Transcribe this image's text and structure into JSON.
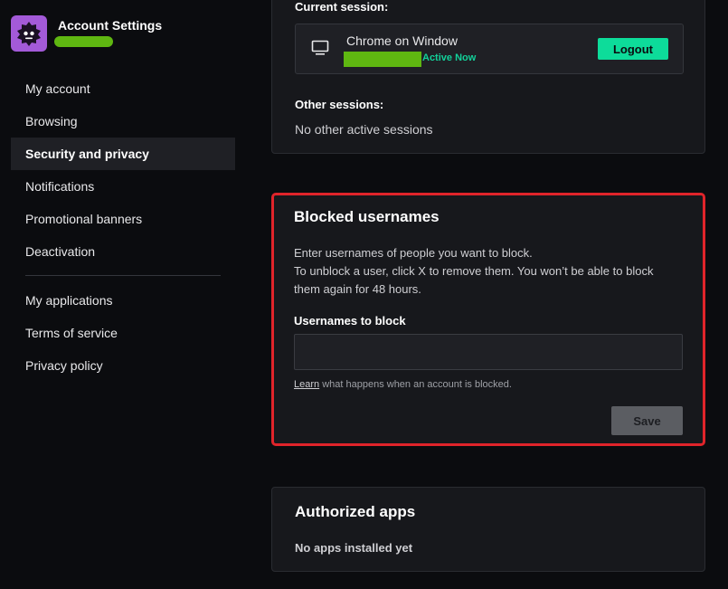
{
  "header": {
    "title": "Account Settings",
    "logo_icon": "robot-face-icon",
    "brand_color": "#a35ad8"
  },
  "sidebar": {
    "items": [
      {
        "label": "My account",
        "active": false
      },
      {
        "label": "Browsing",
        "active": false
      },
      {
        "label": "Security and privacy",
        "active": true
      },
      {
        "label": "Notifications",
        "active": false
      },
      {
        "label": "Promotional banners",
        "active": false
      },
      {
        "label": "Deactivation",
        "active": false
      }
    ],
    "secondary_items": [
      {
        "label": "My applications"
      },
      {
        "label": "Terms of service"
      },
      {
        "label": "Privacy policy"
      }
    ]
  },
  "sessions": {
    "current_label": "Current session:",
    "current": {
      "device": "Chrome on Window",
      "status": "Active Now",
      "icon": "monitor-icon",
      "logout_label": "Logout"
    },
    "other_label": "Other sessions:",
    "other_empty": "No other active sessions"
  },
  "blocked": {
    "title": "Blocked usernames",
    "description_lines": [
      "Enter usernames of people you want to block.",
      "To unblock a user, click X to remove them. You won’t be able to block",
      "them again for 48 hours."
    ],
    "field_label": "Usernames to block",
    "input_value": "",
    "learn_link": "Learn",
    "learn_rest": " what happens when an account is blocked.",
    "save_label": "Save",
    "highlight_color": "#e0242a"
  },
  "apps": {
    "title": "Authorized apps",
    "empty": "No apps installed yet"
  },
  "colors": {
    "accent_green": "#0ddc9a",
    "status_green": "#12d19a",
    "redaction_green": "#5fb711"
  }
}
